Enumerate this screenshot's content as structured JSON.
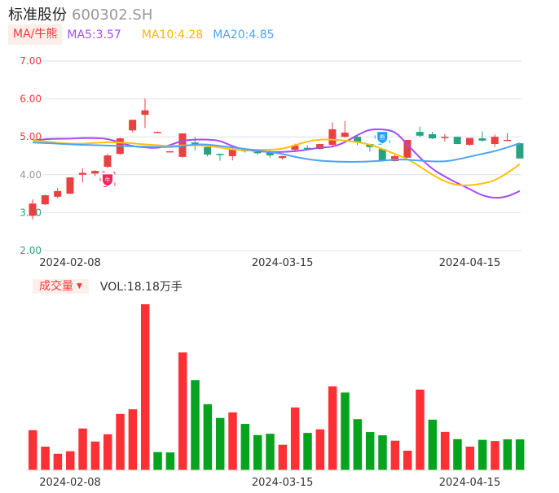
{
  "header": {
    "name": "标准股份",
    "code": "600302.SH"
  },
  "ma_legend": {
    "tag": "MA/牛熊",
    "ma5": "MA5:3.57",
    "ma10": "MA10:4.28",
    "ma20": "MA20:4.85"
  },
  "volume_legend": {
    "tag": "成交量",
    "arrow": "▼",
    "value": "VOL:18.18万手"
  },
  "colors": {
    "up": "#e84142",
    "down": "#27a37f",
    "vol_up": "#fd3035",
    "vol_down": "#06a41e",
    "ma5": "#a64bf4",
    "ma10": "#fdc20b",
    "ma20": "#4ea4f5",
    "grid": "#dde2ee"
  },
  "chart_data": [
    {
      "type": "candlestick",
      "title": "标准股份 600302.SH",
      "ylim": [
        2.0,
        7.0
      ],
      "y_ticks": [
        "7.00",
        "6.00",
        "5.00",
        "4.00",
        "3.00",
        "2.00"
      ],
      "y_tick_values": [
        7,
        6,
        5,
        4,
        3,
        2
      ],
      "x_tick_labels": [
        {
          "index": 3,
          "label": "2024-02-08"
        },
        {
          "index": 20,
          "label": "2024-03-15"
        },
        {
          "index": 35,
          "label": "2024-04-15"
        }
      ],
      "ohlc": [
        [
          2.92,
          3.35,
          2.82,
          3.24
        ],
        [
          3.22,
          3.47,
          3.2,
          3.46
        ],
        [
          3.42,
          3.65,
          3.38,
          3.57
        ],
        [
          3.5,
          3.93,
          3.5,
          3.93
        ],
        [
          4.0,
          4.17,
          3.8,
          4.05
        ],
        [
          4.03,
          4.12,
          3.96,
          4.1
        ],
        [
          4.21,
          4.55,
          4.17,
          4.51
        ],
        [
          4.55,
          4.98,
          4.52,
          4.96
        ],
        [
          5.17,
          5.45,
          5.12,
          5.45
        ],
        [
          5.58,
          6.01,
          5.23,
          5.7
        ],
        [
          5.13,
          5.14,
          5.12,
          5.13
        ],
        [
          4.62,
          4.63,
          4.61,
          4.62
        ],
        [
          4.47,
          5.09,
          4.45,
          5.09
        ],
        [
          4.85,
          5.0,
          4.64,
          4.78
        ],
        [
          4.73,
          4.73,
          4.48,
          4.53
        ],
        [
          4.55,
          4.56,
          4.37,
          4.53
        ],
        [
          4.49,
          4.71,
          4.38,
          4.66
        ],
        [
          4.67,
          4.71,
          4.58,
          4.62
        ],
        [
          4.6,
          4.62,
          4.52,
          4.58
        ],
        [
          4.6,
          4.66,
          4.44,
          4.51
        ],
        [
          4.44,
          4.5,
          4.4,
          4.49
        ],
        [
          4.66,
          4.82,
          4.63,
          4.77
        ],
        [
          4.71,
          4.78,
          4.68,
          4.7
        ],
        [
          4.68,
          4.82,
          4.66,
          4.81
        ],
        [
          4.79,
          5.38,
          4.72,
          5.2
        ],
        [
          5.0,
          5.42,
          4.98,
          5.11
        ],
        [
          5.0,
          5.05,
          4.78,
          4.85
        ],
        [
          4.81,
          4.82,
          4.61,
          4.73
        ],
        [
          4.68,
          4.68,
          4.36,
          4.36
        ],
        [
          4.36,
          4.53,
          4.35,
          4.49
        ],
        [
          4.45,
          4.92,
          4.45,
          4.92
        ],
        [
          5.13,
          5.27,
          4.99,
          5.03
        ],
        [
          5.07,
          5.13,
          4.94,
          4.96
        ],
        [
          5.0,
          5.07,
          4.88,
          5.0
        ],
        [
          5.0,
          5.0,
          4.81,
          4.81
        ],
        [
          4.79,
          4.97,
          4.76,
          4.97
        ],
        [
          4.96,
          5.14,
          4.87,
          4.9
        ],
        [
          4.81,
          5.06,
          4.73,
          5.0
        ],
        [
          4.92,
          5.1,
          4.91,
          4.92
        ],
        [
          4.83,
          4.84,
          4.43,
          4.43
        ]
      ],
      "series": [
        {
          "name": "MA5",
          "values": [
            4.9,
            4.94,
            4.95,
            4.95,
            4.97,
            4.97,
            4.95,
            4.85,
            4.75,
            4.72,
            4.7,
            4.78,
            4.9,
            4.93,
            4.93,
            4.9,
            4.75,
            4.66,
            4.62,
            4.6,
            4.6,
            4.62,
            4.66,
            4.72,
            4.73,
            4.85,
            5.05,
            5.2,
            5.2,
            5.15,
            4.8,
            4.45,
            4.15,
            3.95,
            3.78,
            3.62,
            3.45,
            3.38,
            3.42,
            3.57
          ]
        },
        {
          "name": "MA10",
          "values": [
            4.9,
            4.88,
            4.84,
            4.82,
            4.82,
            4.84,
            4.86,
            4.85,
            4.83,
            4.8,
            4.78,
            4.75,
            4.78,
            4.78,
            4.76,
            4.72,
            4.66,
            4.65,
            4.66,
            4.66,
            4.68,
            4.78,
            4.88,
            4.93,
            4.93,
            4.9,
            4.86,
            4.8,
            4.68,
            4.55,
            4.42,
            4.22,
            4.0,
            3.82,
            3.72,
            3.72,
            3.76,
            3.85,
            4.04,
            4.28
          ]
        },
        {
          "name": "MA20",
          "values": [
            4.85,
            4.84,
            4.82,
            4.8,
            4.79,
            4.78,
            4.77,
            4.76,
            4.75,
            4.74,
            4.73,
            4.73,
            4.76,
            4.8,
            4.8,
            4.76,
            4.72,
            4.68,
            4.64,
            4.6,
            4.55,
            4.47,
            4.41,
            4.37,
            4.35,
            4.34,
            4.34,
            4.35,
            4.37,
            4.4,
            4.4,
            4.37,
            4.35,
            4.35,
            4.4,
            4.48,
            4.55,
            4.62,
            4.72,
            4.83
          ]
        }
      ],
      "signals": [
        {
          "index": 6,
          "label": "牛",
          "kind": "bull",
          "price": 3.88
        },
        {
          "index": 28,
          "label": "熊",
          "kind": "bear",
          "price": 5.0
        }
      ]
    },
    {
      "type": "bar",
      "title": "成交量",
      "unit": "万手",
      "values": [
        23.6,
        13.9,
        9.7,
        11.2,
        24.6,
        16.9,
        21.2,
        33.2,
        35.9,
        97.8,
        10.7,
        10.5,
        69.4,
        53.1,
        38.9,
        30.8,
        34.1,
        27.3,
        20.7,
        21.5,
        15.0,
        37.0,
        22.0,
        24.1,
        49.4,
        45.8,
        30.1,
        22.5,
        20.6,
        17.4,
        11.5,
        47.5,
        29.8,
        22.6,
        18.3,
        13.9,
        17.9,
        17.2,
        18.2,
        18.18
      ],
      "direction": [
        "up",
        "up",
        "up",
        "up",
        "up",
        "up",
        "up",
        "up",
        "up",
        "up",
        "down",
        "down",
        "up",
        "down",
        "down",
        "down",
        "up",
        "down",
        "down",
        "down",
        "up",
        "up",
        "down",
        "up",
        "up",
        "down",
        "down",
        "down",
        "down",
        "up",
        "up",
        "up",
        "down",
        "up",
        "down",
        "up",
        "down",
        "up",
        "down",
        "down"
      ],
      "x_tick_labels": [
        {
          "index": 3,
          "label": "2024-02-08"
        },
        {
          "index": 20,
          "label": "2024-03-15"
        },
        {
          "index": 35,
          "label": "2024-04-15"
        }
      ]
    }
  ]
}
